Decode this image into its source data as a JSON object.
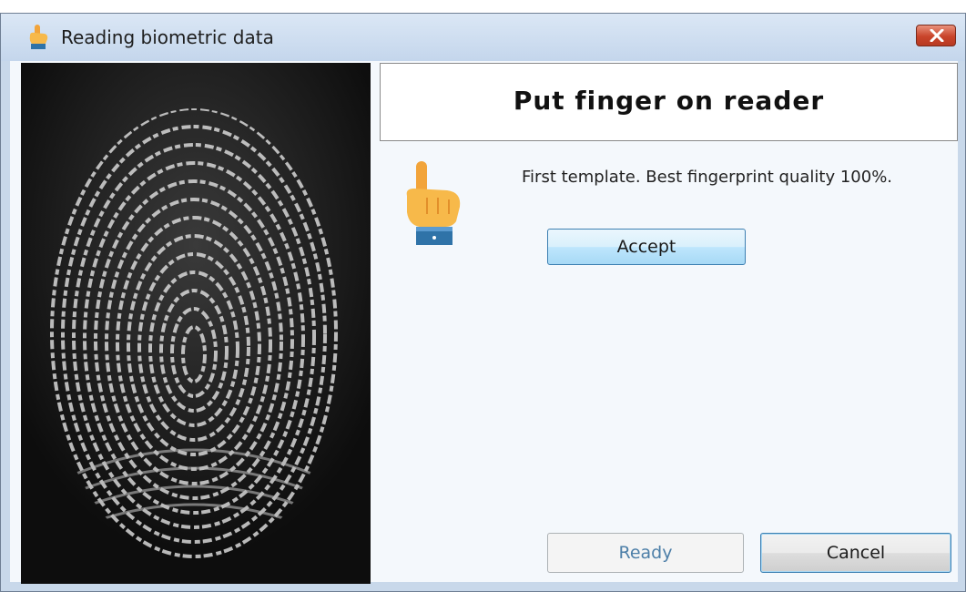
{
  "window": {
    "title": "Reading biometric data",
    "close_icon": "close-icon"
  },
  "main": {
    "heading": "Put finger on reader",
    "message": "First template. Best fingerprint quality 100%.",
    "hand_icon": "pointing-hand-icon",
    "fingerprint_image": "fingerprint-scan-image"
  },
  "buttons": {
    "accept_label": "Accept",
    "ready_label": "Ready",
    "cancel_label": "Cancel"
  },
  "colors": {
    "close_button": "#c9442a",
    "accept_button": "#bee6fd"
  }
}
